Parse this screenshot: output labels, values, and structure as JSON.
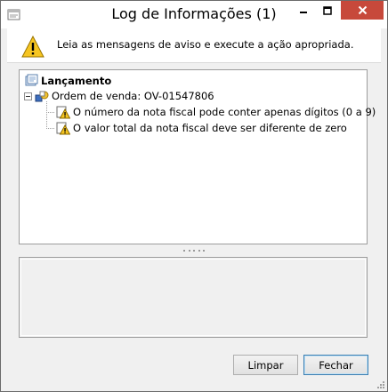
{
  "window": {
    "title": "Log de Informações (1)",
    "close_color": "#c7493b"
  },
  "header": {
    "message": "Leia as mensagens de aviso e execute a ação apropriada.",
    "icon": "warning-icon"
  },
  "tree": {
    "root": {
      "label": "Lançamento",
      "icon": "posting-icon",
      "expanded": true
    },
    "order": {
      "label": "Ordem de venda: OV-01547806",
      "icon": "order-icon",
      "expanded": true
    },
    "messages": [
      {
        "label": "O número da nota fiscal pode conter apenas dígitos (0 a 9)",
        "icon": "warning-small-icon"
      },
      {
        "label": "O valor total da nota fiscal deve ser diferente de zero",
        "icon": "warning-small-icon"
      }
    ]
  },
  "buttons": {
    "clear": "Limpar",
    "close": "Fechar"
  }
}
